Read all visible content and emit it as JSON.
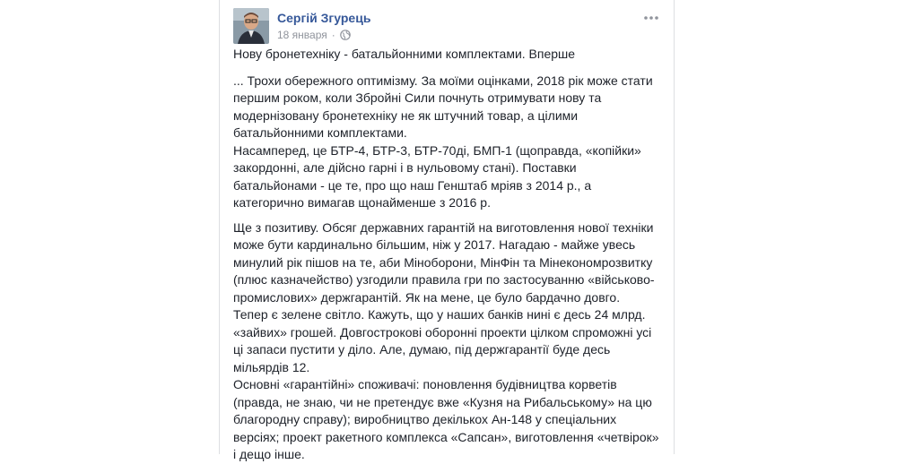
{
  "author": {
    "name": "Сергій Згурець"
  },
  "post": {
    "date": "18 января",
    "separator": "·",
    "privacy_icon": "globe-icon",
    "more_icon": "more-options-icon",
    "title": "Нову бронетехніку - батальйонними комплектами. Вперше",
    "paragraphs": [
      "... Трохи обережного оптимізму. За моїми оцінками, 2018 рік може стати першим роком, коли Збройні Сили почнуть отримувати нову та модернізовану бронетехніку не як штучний товар, а цілими батальйонними комплектами.\nНасамперед, це БТР-4, БТР-3, БТР-70ді, БМП-1 (щоправда, «копійки» закордонні, але дійсно гарні і в нульовому стані). Поставки батальйонами - це те, про що наш Генштаб мріяв з 2014 р., а категорично вимагав щонайменше з 2016 р.",
      "Ще з позитиву. Обсяг державних гарантій на виготовлення нової техніки може бути кардинально більшим, ніж у 2017. Нагадаю - майже увесь минулий рік пішов на те, аби Міноборони, МінФін та Мінекономрозвитку (плюс казначейство) узгодили правила гри по застосуванню «військово-промислових» держгарантій. Як на мене, це було бардачно довго.\nТепер є зелене світло. Кажуть, що у наших банків нині є десь 24 млрд. «зайвих» грошей. Довгострокові оборонні проекти цілком спроможні усі ці запаси пустити у діло. Але, думаю, під держгарантії буде десь мільярдів 12.",
      "Основні «гарантійні» споживачі: поновлення будівництва корветів (правда, не знаю, чи не претендує вже «Кузня на Рибальському» на цю благородну справу); виробництво декількох Ан-148 у спеціальних версіях; проект ракетного комплекса «Сапсан», виготовлення «четвірок» і дещо інше."
    ]
  }
}
